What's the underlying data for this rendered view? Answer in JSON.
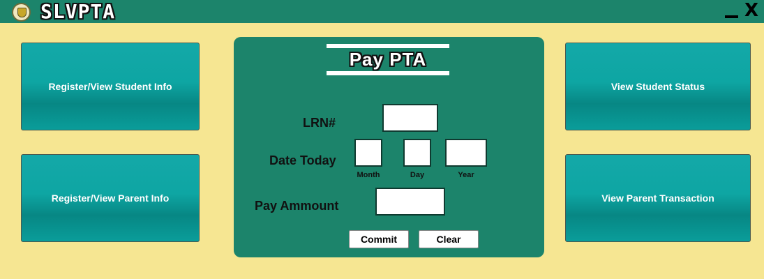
{
  "titlebar": {
    "app_title": "SLVPTA",
    "minimize_icon": "minimize-icon",
    "close_label": "X"
  },
  "left_buttons": [
    {
      "label": "Register/View Student Info"
    },
    {
      "label": "Register/View Parent Info"
    }
  ],
  "right_buttons": [
    {
      "label": "View Student Status"
    },
    {
      "label": "View Parent Transaction"
    }
  ],
  "pay_panel": {
    "title": "Pay PTA",
    "lrn_label": "LRN#",
    "lrn_value": "",
    "date_label": "Date Today",
    "month_label": "Month",
    "day_label": "Day",
    "year_label": "Year",
    "month_value": "",
    "day_value": "",
    "year_value": "",
    "amount_label": "Pay Ammount",
    "amount_value": "",
    "commit_label": "Commit",
    "clear_label": "Clear"
  },
  "colors": {
    "background": "#f6e692",
    "titlebar": "#1c846b",
    "panel": "#1c846b",
    "nav_button": "#0ea6a3"
  }
}
